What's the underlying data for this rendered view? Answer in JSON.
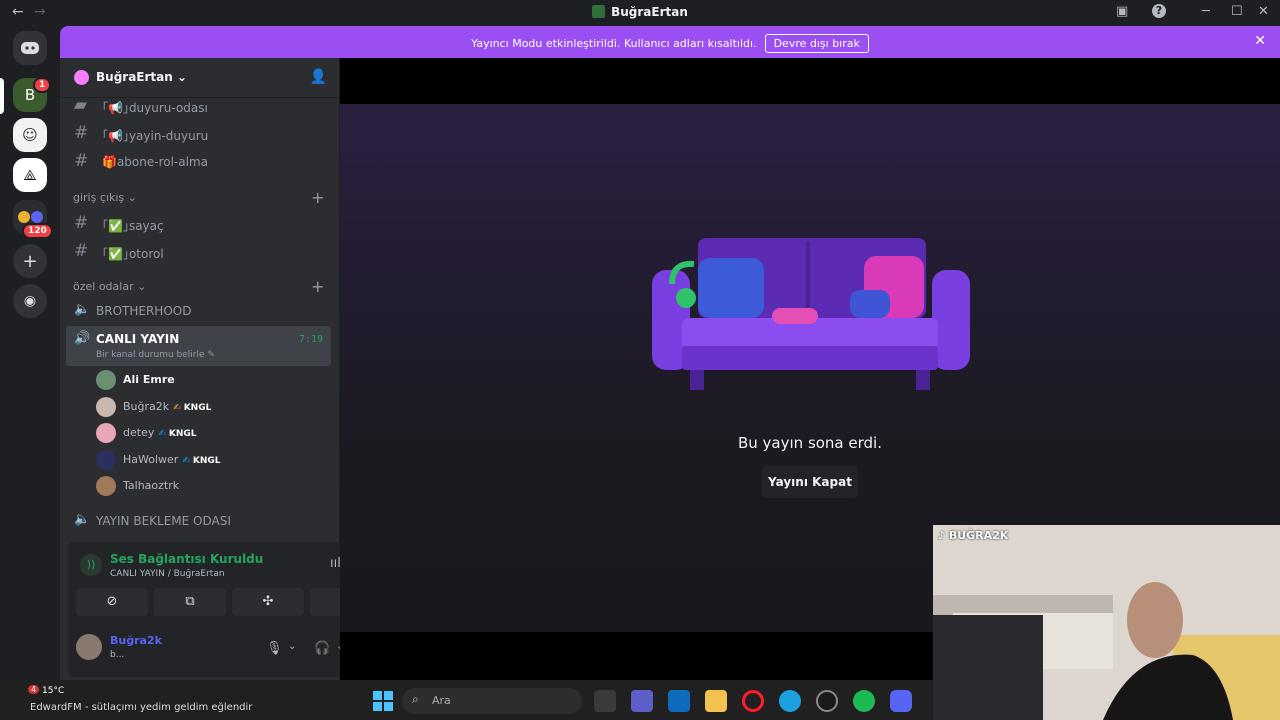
{
  "titlebar": {
    "title": "BuğraErtan"
  },
  "banner": {
    "message": "Yayıncı Modu etkinleştirildi. Kullanıcı adları kısaltıldı.",
    "disable_button": "Devre dışı bırak"
  },
  "rail": {
    "badge_1": "1",
    "badge_120": "120"
  },
  "sidebar": {
    "server_name": "BuğraErtan",
    "channels": [
      {
        "label": "｢📢｣duyuru-odası"
      },
      {
        "label": "｢📢｣yayin-duyuru"
      },
      {
        "label": "🎁abone-rol-alma"
      }
    ],
    "categories": {
      "giris": "giriş çıkış",
      "ozel": "özel odalar"
    },
    "giris_channels": [
      {
        "label": "｢✅｣sayaç"
      },
      {
        "label": "｢✅｣otorol"
      }
    ],
    "voice_channels": {
      "brotherhood": "BROTHERHOOD",
      "live": "CANLI YAYIN",
      "live_status": "Bir kanal durumu belirle",
      "live_time": "7:19",
      "waiting": "YAYIN BEKLEME ODASI"
    },
    "members": [
      {
        "name": "Ali Emre",
        "tag": ""
      },
      {
        "name": "Buğra2k",
        "tag": "KNGL"
      },
      {
        "name": "detey",
        "tag": "KNGL"
      },
      {
        "name": "HaWolwer",
        "tag": "KNGL"
      },
      {
        "name": "Talhaoztrk",
        "tag": ""
      }
    ]
  },
  "voice_panel": {
    "status": "Ses Bağlantısı Kuruldu",
    "channel": "CANLI YAYIN / BuğraErtan"
  },
  "user": {
    "name": "Buğra2k",
    "status": "b..."
  },
  "stage": {
    "ended_text": "Bu yayın sona erdi.",
    "close_button": "Yayını Kapat"
  },
  "camera": {
    "overlay": "BUĞRA2K"
  },
  "taskbar": {
    "weather": "15°C",
    "weather_badge": "4",
    "now_playing": "EdwardFM - sütlaçımı yedim geldim eğlendir",
    "search_placeholder": "Ara"
  },
  "colors": {
    "accent": "#9b4ff3",
    "green": "#23a55a",
    "blurple": "#5865f2"
  }
}
